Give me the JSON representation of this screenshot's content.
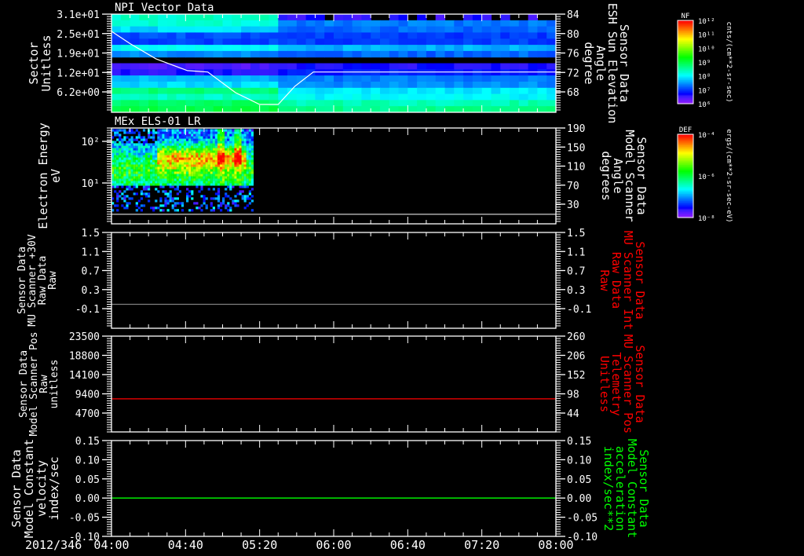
{
  "x_axis": {
    "date": "2012/346",
    "ticks": [
      "04:00",
      "04:40",
      "05:20",
      "06:00",
      "06:40",
      "07:20",
      "08:00"
    ],
    "range": [
      "04:00",
      "08:00"
    ]
  },
  "colors": {
    "background": "#000000",
    "axes": "#ffffff",
    "red_trace": "#ff0000",
    "green_trace": "#00ff00",
    "grey_trace": "#808080"
  },
  "chart_data": [
    {
      "type": "heatmap",
      "title": "NPI Vector Data",
      "ylabel": [
        "Sector",
        "Unitless"
      ],
      "yticks": [
        "3.1e+01",
        "2.5e+01",
        "1.9e+01",
        "1.2e+01",
        "6.2e+00"
      ],
      "ylim": [
        0,
        31
      ],
      "y2label": [
        "Sensor Data",
        "ESH Sun Elevation",
        "Angle",
        "degree"
      ],
      "y2ticks": [
        "84",
        "80",
        "76",
        "72",
        "68"
      ],
      "y2lim": [
        64,
        84
      ],
      "colorbar": {
        "label": "NF",
        "ticks": [
          "10¹²",
          "10¹¹",
          "10¹⁰",
          "10⁹",
          "10⁸",
          "10⁷",
          "10⁶"
        ],
        "log10_range": [
          6,
          12
        ],
        "units": "cnts/(cm**2-sr-sec)"
      },
      "rows_log10_before_0530": [
        8.3,
        8.2,
        7.8,
        7.1,
        7.0,
        8.0,
        7.4,
        null,
        6.4,
        6.6,
        7.6,
        7.8,
        8.7,
        8.3,
        8.8,
        9.0
      ],
      "rows_log10_after_0530": [
        6.5,
        7.3,
        7.2,
        7.0,
        7.0,
        7.6,
        7.2,
        null,
        6.6,
        6.8,
        7.3,
        7.4,
        7.9,
        8.0,
        8.4,
        8.6
      ],
      "line": {
        "name": "ESH Sun Elevation",
        "x": [
          "04:00",
          "04:10",
          "04:24",
          "04:41",
          "04:52",
          "05:07",
          "05:20",
          "05:30",
          "05:39",
          "05:49",
          "08:00"
        ],
        "y": [
          80.5,
          78.0,
          74.9,
          72.5,
          72.2,
          68.0,
          65.6,
          65.6,
          69.3,
          72.2,
          72.2
        ]
      }
    },
    {
      "type": "heatmap",
      "title": "MEx ELS-01 LR",
      "ylabel": [
        "Electron Energy",
        "eV"
      ],
      "yticks": [
        "10²",
        "10¹"
      ],
      "yscale": "log",
      "ylim": [
        1,
        210
      ],
      "y2label": [
        "Sensor Data",
        "Model Scanner",
        "Angle",
        "degrees"
      ],
      "y2ticks": [
        "190",
        "150",
        "110",
        "70",
        "30"
      ],
      "y2lim": [
        -11,
        190
      ],
      "colorbar": {
        "label": "DEF",
        "ticks": [
          "10⁻⁴",
          "10⁻⁶",
          "10⁻⁸"
        ],
        "log10_range": [
          -8,
          -4
        ],
        "units": "ergs/(cm**2-sr-sec-eV)"
      },
      "data_extent": [
        "04:00",
        "05:16"
      ],
      "line": {
        "name": "Model Scanner Angle",
        "x": [
          "04:00",
          "08:00"
        ],
        "y": [
          9,
          9
        ]
      }
    },
    {
      "type": "line",
      "ylabel": [
        "Sensor Data",
        "MU Scanner +30V",
        "Raw Data",
        "Raw"
      ],
      "yticks": [
        "1.5",
        "1.1",
        "0.7",
        "0.3",
        "-0.1"
      ],
      "ylim": [
        -0.5,
        1.5
      ],
      "y2label": [
        "Sensor Data",
        "MU Scanner Int",
        "Raw Data",
        "Raw"
      ],
      "y2ticks": [
        "1.5",
        "1.1",
        "0.7",
        "0.3",
        "-0.1"
      ],
      "y2lim": [
        -0.5,
        1.5
      ],
      "y2label_color": "#ff0000",
      "series": [
        {
          "x": [
            "04:00",
            "08:00"
          ],
          "y": [
            0,
            0
          ],
          "color": "#808080"
        }
      ]
    },
    {
      "type": "line",
      "ylabel": [
        "Sensor Data",
        "Model Scanner Pos",
        "Raw",
        "unitless"
      ],
      "yticks": [
        "23500",
        "18800",
        "14100",
        "9400",
        "4700"
      ],
      "ylim": [
        0,
        23500
      ],
      "y2label": [
        "Sensor Data",
        "MU Scanner Pos",
        "Telemetry",
        "Unitless"
      ],
      "y2ticks": [
        "260",
        "206",
        "152",
        "98",
        "44"
      ],
      "y2lim": [
        -9,
        260
      ],
      "y2label_color": "#ff0000",
      "series": [
        {
          "x": [
            "04:00",
            "08:00"
          ],
          "y": [
            8100,
            8100
          ],
          "color": "#ff0000"
        }
      ]
    },
    {
      "type": "line",
      "ylabel": [
        "Sensor Data",
        "Model Constant",
        "velocity",
        "index/sec"
      ],
      "yticks": [
        "0.15",
        "0.10",
        "0.05",
        "0.00",
        "-0.05",
        "-0.10"
      ],
      "ylim": [
        -0.1,
        0.15
      ],
      "y2label": [
        "Sensor Data",
        "Model Constant",
        "acceleration",
        "index/sec**2"
      ],
      "y2ticks": [
        "0.15",
        "0.10",
        "0.05",
        "0.00",
        "-0.05",
        "-0.10"
      ],
      "y2lim": [
        -0.1,
        0.15
      ],
      "y2label_color": "#00ff00",
      "series": [
        {
          "x": [
            "04:00",
            "08:00"
          ],
          "y": [
            0,
            0
          ],
          "color": "#00ff00"
        }
      ]
    }
  ]
}
